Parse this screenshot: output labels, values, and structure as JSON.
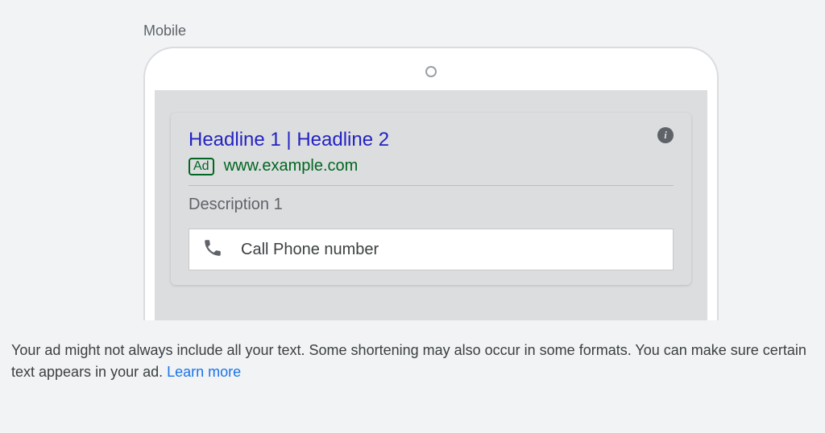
{
  "preview": {
    "label": "Mobile"
  },
  "ad": {
    "headline": "Headline 1 | Headline 2",
    "badge": "Ad",
    "url": "www.example.com",
    "description": "Description 1",
    "call_label": "Call Phone number"
  },
  "disclaimer": {
    "text": "Your ad might not always include all your text. Some shortening may also occur in some formats. You can make sure certain text appears in your ad. ",
    "link": "Learn more"
  }
}
